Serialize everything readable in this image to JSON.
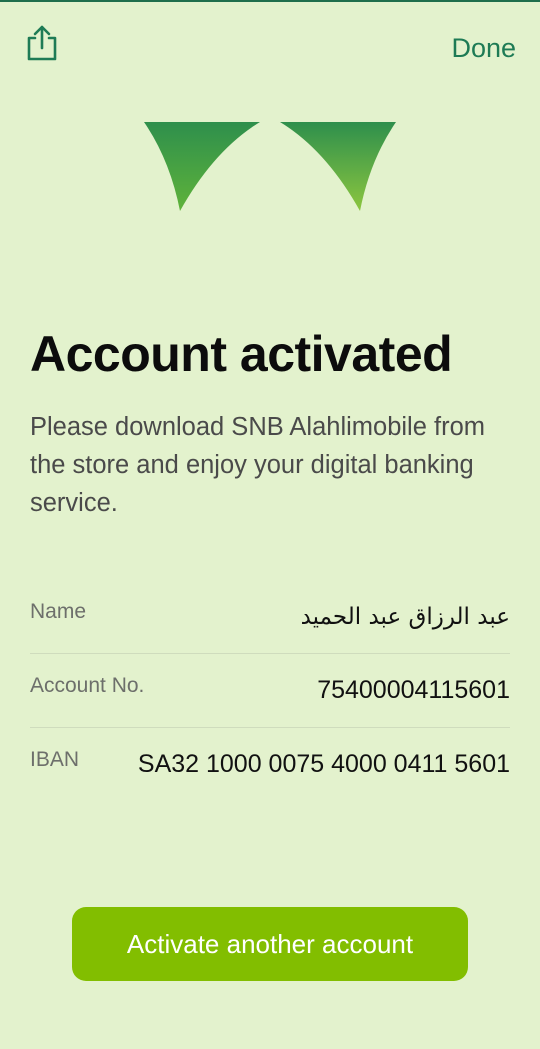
{
  "header": {
    "share_icon": "share-icon",
    "done_label": "Done"
  },
  "brand": {
    "logo_icon": "snb-logo-icon",
    "colors": {
      "dark_green": "#1e7b55",
      "lime_green": "#82be00",
      "background": "#e3f2cd"
    }
  },
  "main": {
    "title": "Account activated",
    "subtitle": "Please download SNB Alahlimobile from the store and enjoy your digital banking service."
  },
  "details": [
    {
      "label": "Name",
      "value": "عبد الرزاق عبد الحميد"
    },
    {
      "label": "Account No.",
      "value": "75400004115601"
    },
    {
      "label": "IBAN",
      "value": "SA32 1000 0075 4000 0411 5601"
    }
  ],
  "footer": {
    "activate_label": "Activate another account"
  }
}
